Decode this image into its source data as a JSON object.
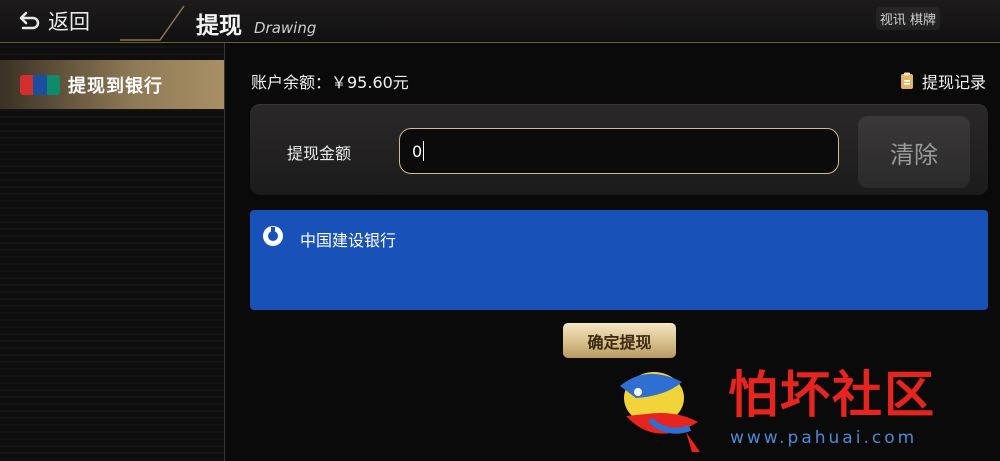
{
  "header": {
    "back_label": "返回",
    "title": "提现",
    "subtitle": "Drawing",
    "brand": "视讯 棋牌"
  },
  "sidebar": {
    "items": [
      {
        "label": "提现到银行",
        "icon": "unionpay-icon",
        "active": true
      }
    ]
  },
  "main": {
    "balance_text": "账户余额：￥95.60元",
    "records_label": "提现记录",
    "amount_label": "提现金额",
    "amount_value": "0",
    "clear_label": "清除",
    "bank_name": "中国建设银行",
    "confirm_label": "确定提现"
  },
  "watermark": {
    "text": "怕坏社区",
    "url": "www.pahuai.com"
  },
  "colors": {
    "accent_gold": "#d2b98a",
    "bank_blue": "#1852b8",
    "watermark_red": "#e8241f"
  }
}
